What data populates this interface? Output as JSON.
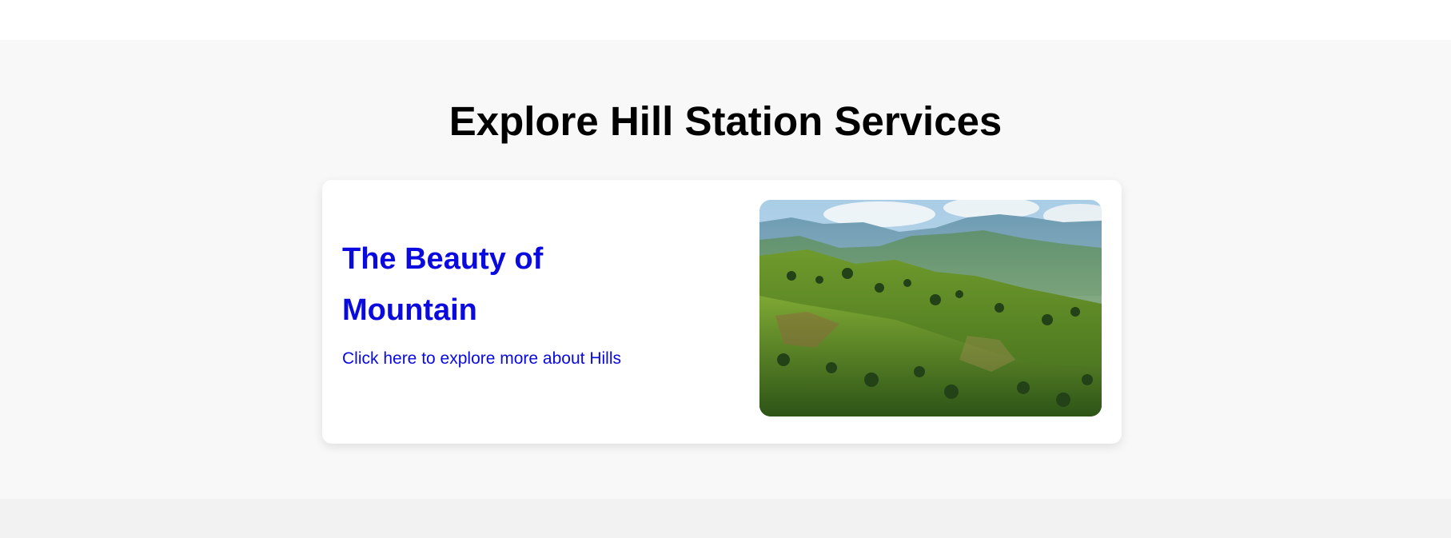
{
  "page": {
    "section_title": "Explore Hill Station Services"
  },
  "card": {
    "heading": "The Beauty of Mountain",
    "link_text": "Click here to explore more about Hills",
    "image_alt": "Green hills and mountains landscape"
  },
  "colors": {
    "accent": "#0a0ae0",
    "section_background": "#f8f8f8",
    "card_background": "#ffffff",
    "title": "#000000"
  }
}
